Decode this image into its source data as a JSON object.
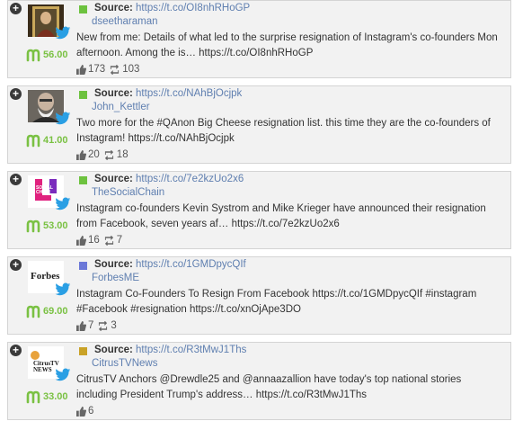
{
  "colors": {
    "score_green": "#7ac143",
    "link_blue": "#5f7fb0",
    "twitter_blue": "#2a9fe4"
  },
  "source_label": "Source:",
  "items": [
    {
      "source_url": "https://t.co/OI8nhRHoGP",
      "handle": "dseetharaman",
      "score": "56.00",
      "tag_color": "#6dc23f",
      "text": "New from me: Details of what led to the surprise resignation of Instagram's co-founders Mon afternoon. Among the is… https://t.co/OI8nhRHoGP",
      "likes": "173",
      "retweets": "103",
      "avatar": "painting-portrait"
    },
    {
      "source_url": "https://t.co/NAhBjOcjpk",
      "handle": "John_Kettler",
      "score": "41.00",
      "tag_color": "#6dc23f",
      "text": "Two more for the #QAnon Big Cheese resignation list. this time they are the co-founders of Instagram! https://t.co/NAhBjOcjpk",
      "likes": "20",
      "retweets": "18",
      "avatar": "man-portrait"
    },
    {
      "source_url": "https://t.co/7e2kzUo2x6",
      "handle": "TheSocialChain",
      "score": "53.00",
      "tag_color": "#6dc23f",
      "text": "Instagram co-founders Kevin Systrom and Mike Krieger have announced their resignation from Facebook, seven years af… https://t.co/7e2kzUo2x6",
      "likes": "16",
      "retweets": "7",
      "avatar": "social-chain-logo",
      "avatar_text": "SOCIAL CHAIN"
    },
    {
      "source_url": "https://t.co/1GMDpycQIf",
      "handle": "ForbesME",
      "score": "69.00",
      "tag_color": "#6b78d8",
      "text": "Instagram Co-Founders To Resign From Facebook https://t.co/1GMDpycQIf #instagram #Facebook #resignation https://t.co/xnOjApe3DO",
      "likes": "7",
      "retweets": "3",
      "avatar": "forbes-logo",
      "avatar_text": "Forbes"
    },
    {
      "source_url": "https://t.co/R3tMwJ1Ths",
      "handle": "CitrusTVNews",
      "score": "33.00",
      "tag_color": "#c9a227",
      "text": "CitrusTV Anchors @Drewdle25 and @annaazallion have today's top national stories including President Trump's address… https://t.co/R3tMwJ1Ths",
      "likes": "6",
      "retweets": "",
      "avatar": "citrustv-logo",
      "avatar_text": "CitrusTV NEWS"
    }
  ]
}
